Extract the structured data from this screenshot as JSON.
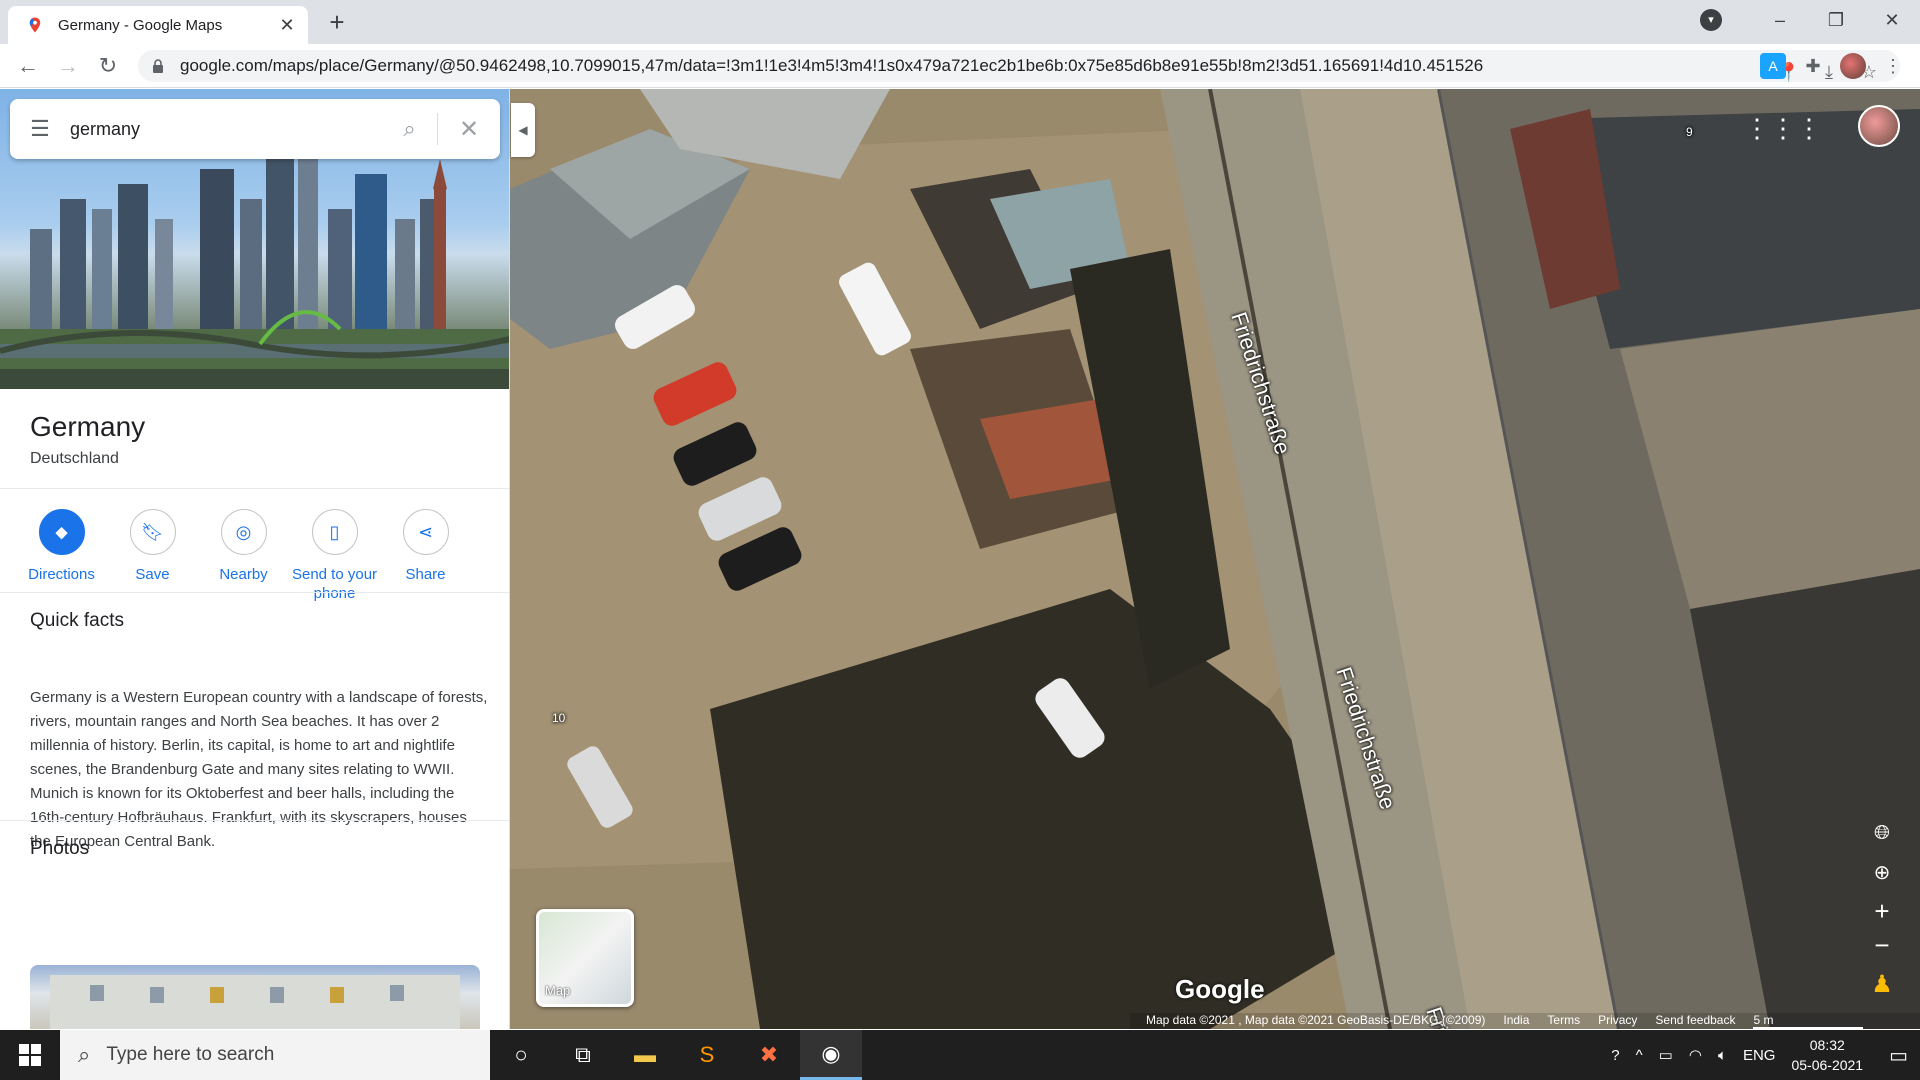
{
  "browser": {
    "tab_title": "Germany - Google Maps",
    "url": "google.com/maps/place/Germany/@50.9462498,10.7099015,47m/data=!3m1!1e3!4m5!3m4!1s0x479a721ec2b1be6b:0x75e85d6b8e91e55b!8m2!3d51.165691!4d10.451526"
  },
  "search": {
    "value": "germany"
  },
  "place": {
    "title": "Germany",
    "subtitle": "Deutschland"
  },
  "actions": [
    {
      "label": "Directions"
    },
    {
      "label": "Save"
    },
    {
      "label": "Nearby"
    },
    {
      "label": "Send to your phone"
    },
    {
      "label": "Share"
    }
  ],
  "quick_facts": {
    "heading": "Quick facts",
    "text": "Germany is a Western European country with a landscape of forests, rivers, mountain ranges and North Sea beaches. It has over 2 millennia of history. Berlin, its capital, is home to art and nightlife scenes, the Brandenburg Gate and many sites relating to WWII. Munich is known for its Oktoberfest and beer halls, including the 16th-century Hofbräuhaus. Frankfurt, with its skyscrapers, houses the European Central Bank."
  },
  "photos": {
    "heading": "Photos"
  },
  "map": {
    "street_labels": [
      "Friedrichstraße",
      "Friedrichstraße",
      "Friedrichs"
    ],
    "house_numbers": [
      "9",
      "10"
    ],
    "layer_toggle_label": "Map",
    "logo": "Google",
    "attribution": {
      "data": "Map data ©2021 , Map data ©2021 GeoBasis-DE/BKG (©2009)",
      "region": "India",
      "terms": "Terms",
      "privacy": "Privacy",
      "feedback": "Send feedback",
      "scale": "5 m"
    }
  },
  "taskbar": {
    "search_placeholder": "Type here to search",
    "language": "ENG",
    "time": "08:32",
    "date": "05-06-2021"
  },
  "colors": {
    "accent": "#1a73e8"
  }
}
